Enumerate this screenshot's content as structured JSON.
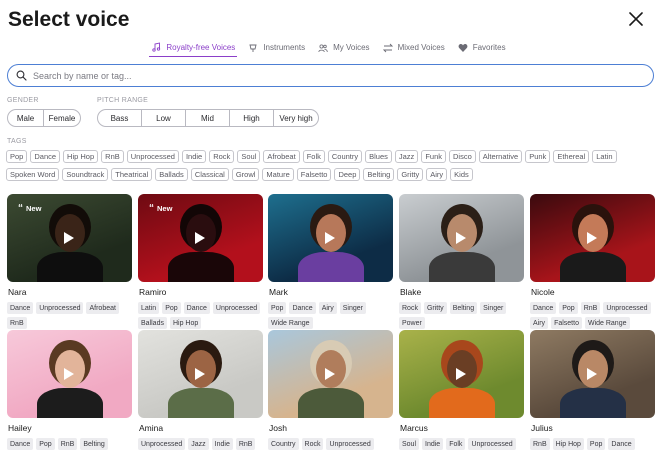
{
  "header": {
    "title": "Select voice"
  },
  "tabs": [
    {
      "label": "Royalty-free Voices",
      "icon": "music-note-icon",
      "active": true
    },
    {
      "label": "Instruments",
      "icon": "instrument-icon",
      "active": false
    },
    {
      "label": "My Voices",
      "icon": "users-icon",
      "active": false
    },
    {
      "label": "Mixed Voices",
      "icon": "swap-icon",
      "active": false
    },
    {
      "label": "Favorites",
      "icon": "heart-icon",
      "active": false
    }
  ],
  "search": {
    "placeholder": "Search by name or tag..."
  },
  "filters": {
    "gender_label": "GENDER",
    "gender_options": [
      "Male",
      "Female"
    ],
    "pitch_label": "PITCH RANGE",
    "pitch_options": [
      "Bass",
      "Low",
      "Mid",
      "High",
      "Very high"
    ],
    "tags_label": "TAGS",
    "tags_row1": [
      "Pop",
      "Dance",
      "Hip Hop",
      "RnB",
      "Unprocessed",
      "Indie",
      "Rock",
      "Soul",
      "Afrobeat",
      "Folk",
      "Country",
      "Blues",
      "Jazz",
      "Funk",
      "Disco",
      "Alternative",
      "Punk",
      "Ethereal",
      "Latin"
    ],
    "tags_row2": [
      "Spoken Word",
      "Soundtrack",
      "Theatrical",
      "Ballads",
      "Classical",
      "Growl",
      "Mature",
      "Falsetto",
      "Deep",
      "Belting",
      "Gritty",
      "Airy",
      "Kids"
    ]
  },
  "voices": [
    {
      "name": "Nara",
      "badge": "New",
      "tags": [
        "Dance",
        "Unprocessed",
        "Afrobeat",
        "RnB"
      ],
      "bg": "#1f2a1c",
      "bg2": "#3c4a32",
      "skin": "#3a2418",
      "hair": "#120c08",
      "shirt": "#0e0e0e"
    },
    {
      "name": "Ramiro",
      "badge": "New",
      "tags": [
        "Latin",
        "Pop",
        "Dance",
        "Unprocessed",
        "Ballads",
        "Hip Hop"
      ],
      "bg": "#b3101c",
      "bg2": "#6e0a12",
      "skin": "#2a0d0f",
      "hair": "#120606",
      "shirt": "#1a0608"
    },
    {
      "name": "Mark",
      "badge": "",
      "tags": [
        "Pop",
        "Dance",
        "Airy",
        "Singer",
        "Wide Range"
      ],
      "bg": "#0d2c46",
      "bg2": "#1e6f8e",
      "skin": "#b7785a",
      "hair": "#2a1a12",
      "shirt": "#6a3ea0"
    },
    {
      "name": "Blake",
      "badge": "",
      "tags": [
        "Rock",
        "Gritty",
        "Belting",
        "Singer",
        "Power"
      ],
      "bg": "#8f9498",
      "bg2": "#c9cdd0",
      "skin": "#b88a6c",
      "hair": "#2b1f17",
      "shirt": "#3a3a3a"
    },
    {
      "name": "Nicole",
      "badge": "",
      "tags": [
        "Dance",
        "Pop",
        "RnB",
        "Unprocessed",
        "Airy",
        "Falsetto",
        "Wide Range"
      ],
      "bg": "#a8141a",
      "bg2": "#3a0a0e",
      "skin": "#c47a58",
      "hair": "#2a120c",
      "shirt": "#1a1a1a"
    },
    {
      "name": "Hailey",
      "badge": "",
      "tags": [
        "Dance",
        "Pop",
        "RnB",
        "Belting"
      ],
      "bg": "#f1a9c3",
      "bg2": "#f7c9da",
      "skin": "#e2b49a",
      "hair": "#5a3a22",
      "shirt": "#1c1c1c"
    },
    {
      "name": "Amina",
      "badge": "",
      "tags": [
        "Unprocessed",
        "Jazz",
        "Indie",
        "RnB"
      ],
      "bg": "#c9c9c5",
      "bg2": "#e2e2de",
      "skin": "#9c6444",
      "hair": "#2a1a10",
      "shirt": "#5b6d48"
    },
    {
      "name": "Josh",
      "badge": "",
      "tags": [
        "Country",
        "Rock",
        "Unprocessed"
      ],
      "bg": "#d6b48e",
      "bg2": "#a9c7dc",
      "skin": "#b07d5c",
      "hair": "#d8cbb4",
      "shirt": "#4c5a3a"
    },
    {
      "name": "Marcus",
      "badge": "",
      "tags": [
        "Soul",
        "Indie",
        "Folk",
        "Unprocessed"
      ],
      "bg": "#6e8a2e",
      "bg2": "#a9b24a",
      "skin": "#6a3e24",
      "hair": "#a8471c",
      "shirt": "#e26a1c"
    },
    {
      "name": "Julius",
      "badge": "",
      "tags": [
        "RnB",
        "Hip Hop",
        "Pop",
        "Dance"
      ],
      "bg": "#5a4a3c",
      "bg2": "#8e7a62",
      "skin": "#b98866",
      "hair": "#1e1a18",
      "shirt": "#243046"
    }
  ]
}
